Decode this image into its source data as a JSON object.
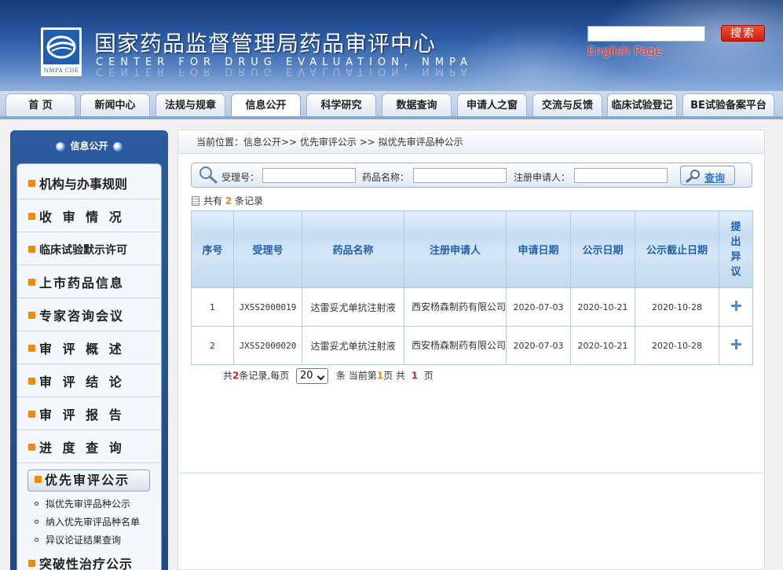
{
  "header": {
    "logo_text": "NMPA CDE",
    "title": "国家药品监督管理局药品审评中心",
    "subtitle": "CENTER FOR DRUG EVALUATION, NMPA",
    "search_button": "搜索",
    "english_link": "English Page"
  },
  "nav": {
    "tabs": [
      "首 页",
      "新闻中心",
      "法规与规章",
      "信息公开",
      "科学研究",
      "数据查询",
      "申请人之窗",
      "交流与反馈",
      "临床试验登记",
      "BE试验备案平台"
    ],
    "active_index": 3
  },
  "sidebar": {
    "title": "信息公开",
    "items": [
      "机构与办事规则",
      "收 审 情 况",
      "临床试验默示许可",
      "上市药品信息",
      "专家咨询会议",
      "审 评 概 述",
      "审 评 结 论",
      "审 评 报 告",
      "进 度 查 询"
    ],
    "active_item": "优先审评公示",
    "sub_items": [
      "拟优先审评品种公示",
      "纳入优先审评品种名单",
      "异议论证结果查询"
    ],
    "next_item": "突破性治疗公示"
  },
  "breadcrumb": "当前位置：信息公开>> 优先审评公示 >> 拟优先审评品种公示",
  "filter": {
    "accept_no_label": "受理号：",
    "drug_name_label": "药品名称：",
    "applicant_label": "注册申请人：",
    "query_button": "查询"
  },
  "count": {
    "prefix": "共有",
    "total": "2",
    "suffix": "条记录"
  },
  "table": {
    "headers": [
      "序号",
      "受理号",
      "药品名称",
      "注册申请人",
      "申请日期",
      "公示日期",
      "公示截止日期",
      "提出异议"
    ],
    "rows": [
      [
        "1",
        "JXSS2000019",
        "达雷妥尤单抗注射液",
        "西安杨森制药有限公司",
        "2020-07-03",
        "2020-10-21",
        "2020-10-28"
      ],
      [
        "2",
        "JXSS2000020",
        "达雷妥尤单抗注射液",
        "西安杨森制药有限公司",
        "2020-07-03",
        "2020-10-21",
        "2020-10-28"
      ]
    ]
  },
  "pager": {
    "t1": "共",
    "total": "2",
    "t2": "条记录,每页",
    "per_page": "20",
    "t3": "条 当前第",
    "current": "1",
    "t4": "页 共",
    "pages": "1",
    "t5": "页"
  },
  "colors": {
    "header_blue": "#2e5ea8",
    "link_blue": "#1f62b0",
    "accent_orange": "#f08a00",
    "red": "#d02020"
  }
}
